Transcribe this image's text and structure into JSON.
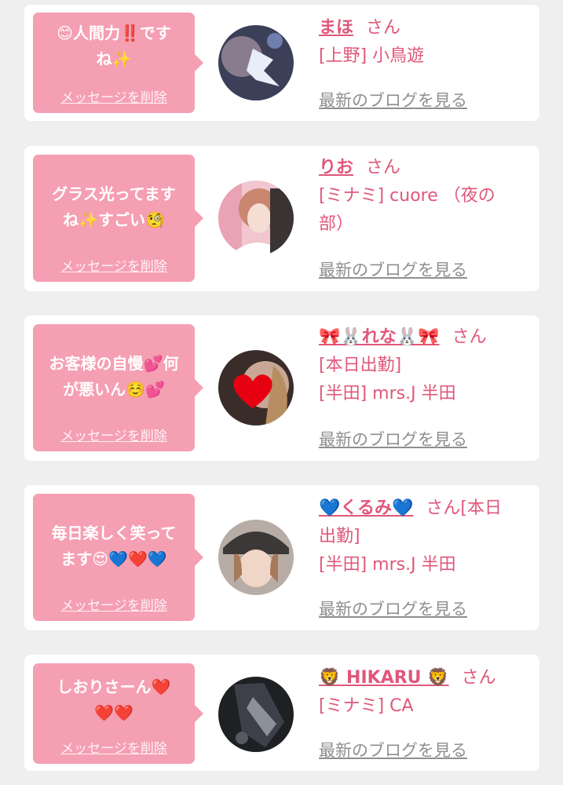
{
  "delete_label": "メッセージを削除",
  "blog_label": "最新のブログを見る",
  "san_label": "さん",
  "colors": {
    "background": "#efefef",
    "bubble": "#f59fb2",
    "accent": "#e0577a",
    "link_gray": "#8f8f8f"
  },
  "cards": [
    {
      "message_line1": "😊人間力‼️です",
      "message_line2": "ね✨",
      "name": "まほ",
      "name_suffix": "さん",
      "info_lines": [
        "[上野] 小鳥遊"
      ]
    },
    {
      "message_line1": "グラス光ってます",
      "message_line2": "ね✨すごい🧐",
      "name": "りお",
      "name_suffix": "さん",
      "info_lines": [
        "[ミナミ] cuore （夜の",
        "部）"
      ]
    },
    {
      "message_line1": "お客様の自慢💕何",
      "message_line2": "が悪いん☺️💕",
      "name": "🎀🐰れな🐰🎀",
      "name_suffix": "さん",
      "info_lines": [
        "[本日出勤]",
        "[半田] mrs.J 半田"
      ]
    },
    {
      "message_line1": "毎日楽しく笑って",
      "message_line2": "ます😍💙❤️💙",
      "name": "💙くるみ💙",
      "name_suffix": "さん[本日",
      "info_lines": [
        "出勤]",
        "[半田] mrs.J 半田"
      ]
    },
    {
      "message_line1": "しおりさーん❤️",
      "message_line2": "❤️❤️",
      "name": "🦁 HIKARU 🦁",
      "name_suffix": "さん",
      "info_lines": [
        "[ミナミ] CA"
      ]
    }
  ]
}
